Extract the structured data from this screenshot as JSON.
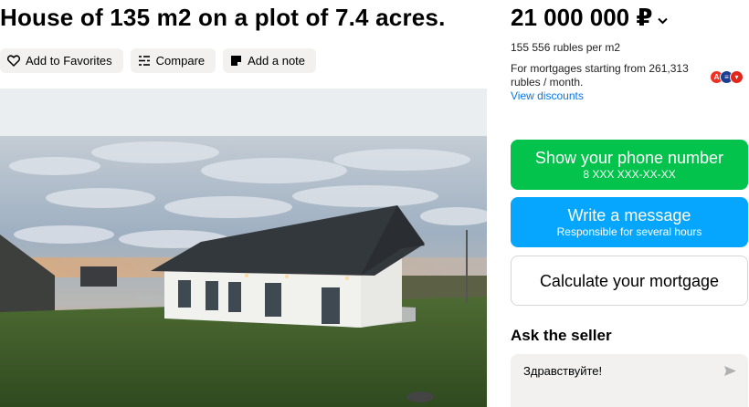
{
  "listing": {
    "title": "House of 135 m2 on a plot of 7.4 acres."
  },
  "actions": [
    {
      "label": "Add to Favorites",
      "icon": "heart-icon"
    },
    {
      "label": "Compare",
      "icon": "compare-icon"
    },
    {
      "label": "Add a note",
      "icon": "note-icon"
    }
  ],
  "price": {
    "value": "21 000 000 ₽",
    "per_m2": "155 556 rubles per m2",
    "mortgage_text": "For mortgages starting from 261,313 rubles / month.",
    "discounts_link": "View discounts"
  },
  "contact": {
    "phone_label": "Show your phone number",
    "phone_masked": "8 XXX XXX-XX-XX",
    "message_label": "Write a message",
    "message_sub": "Responsible for several hours",
    "mortgage_calc_label": "Calculate your mortgage"
  },
  "seller": {
    "heading": "Ask the seller",
    "message_value": "Здравствуйте!"
  },
  "colors": {
    "phone_button": "#04c34d",
    "message_button": "#06a6ff",
    "link": "#0a76e8",
    "chip_bg": "#f2f1f0"
  }
}
